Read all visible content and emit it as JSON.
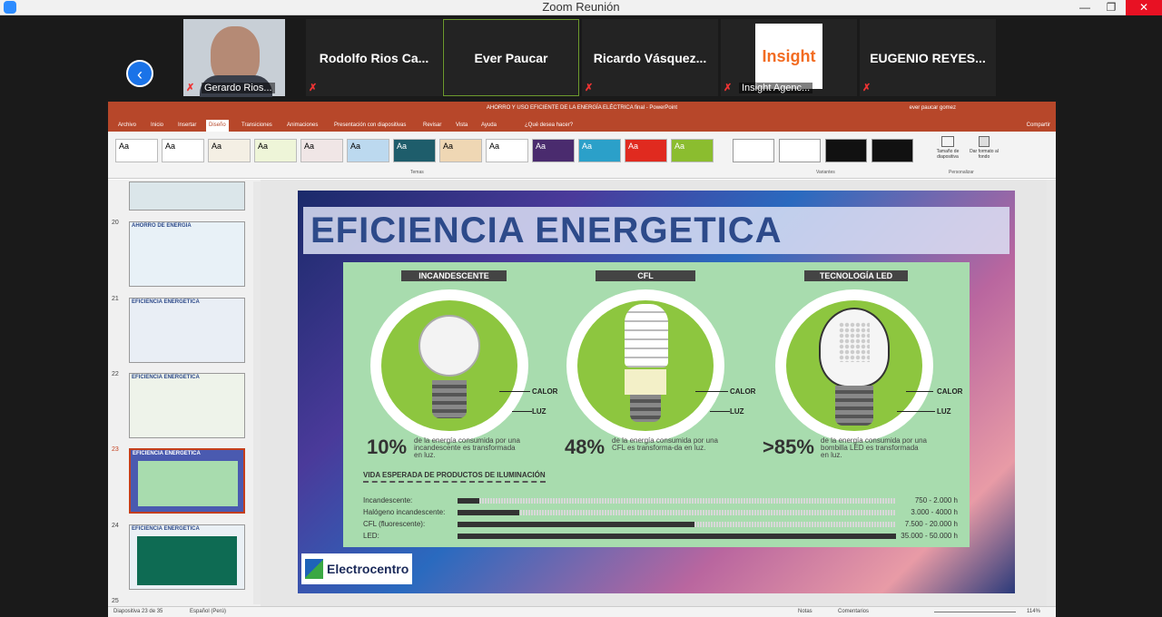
{
  "window": {
    "title": "Zoom Reunión",
    "minimize": "—",
    "restore": "❐",
    "close": "✕"
  },
  "participants": [
    {
      "name": "Gerardo Rios",
      "label": "Gerardo Rios..."
    },
    {
      "name": "Rodolfo Rios Ca..."
    },
    {
      "name": "Ever Paucar"
    },
    {
      "name": "Ricardo Vásquez..."
    },
    {
      "name": "Insight Agenc...",
      "label": "Insight Agenc..."
    },
    {
      "name": "EUGENIO REYES..."
    }
  ],
  "ppt": {
    "doc_title": "AHORRO Y USO EFICIENTE DE LA ENERGÍA ELÉCTRICA final  -  PowerPoint",
    "user": "ever paucar gomez",
    "share": "Compartir",
    "tabs": [
      "Archivo",
      "Inicio",
      "Insertar",
      "Diseño",
      "Transiciones",
      "Animaciones",
      "Presentación con diapositivas",
      "Revisar",
      "Vista",
      "Ayuda",
      "¿Qué desea hacer?"
    ],
    "groups": {
      "themes": "Temas",
      "variants": "Variantes",
      "customize": "Personalizar"
    },
    "custom_buttons": [
      "Tamaño de diapositiva",
      "Dar formato al fondo"
    ],
    "theme_sample": "Aa",
    "status_left": "Diapositiva 23 de 35",
    "language": "Español (Perú)",
    "notes": "Notas",
    "comments": "Comentarios",
    "zoom": "114%"
  },
  "thumbnails": [
    {
      "num": "",
      "title": ""
    },
    {
      "num": "20",
      "title": "AHORRO DE ENERGIA"
    },
    {
      "num": "21",
      "title": "EFICIENCIA ENERGETICA"
    },
    {
      "num": "22",
      "title": "EFICIENCIA ENERGETICA"
    },
    {
      "num": "23",
      "title": "EFICIENCIA ENERGETICA"
    },
    {
      "num": "24",
      "title": "EFICIENCIA ENERGETICA"
    },
    {
      "num": "25",
      "title": "EFICIENCIA ENERGETICA"
    }
  ],
  "slide": {
    "title": "EFICIENCIA ENERGETICA",
    "bulbs": [
      {
        "label": "INCANDESCENTE",
        "pct": "10%",
        "desc": "de la energía consumida por una incandescente es transformada en luz."
      },
      {
        "label": "CFL",
        "pct": "48%",
        "desc": "de la energía consumida por una CFL es transforma-da en luz."
      },
      {
        "label": "TECNOLOGÍA LED",
        "pct": ">85%",
        "desc": "de la energía consumida por una bombilla LED es transformada en luz."
      }
    ],
    "calor": "CALOR",
    "luz": "LUZ",
    "vida_title": "VIDA ESPERADA DE PRODUCTOS DE ILUMINACIÓN",
    "vida": [
      {
        "name": "Incandescente:",
        "value": "750 - 2.000 h",
        "fill": 0.05
      },
      {
        "name": "Halógeno incandescente:",
        "value": "3.000 - 4000 h",
        "fill": 0.14
      },
      {
        "name": "CFL (fluorescente):",
        "value": "7.500 - 20.000 h",
        "fill": 0.54
      },
      {
        "name": "LED:",
        "value": "35.000 - 50.000 h",
        "fill": 1.0
      }
    ],
    "brand": "Electrocentro"
  }
}
